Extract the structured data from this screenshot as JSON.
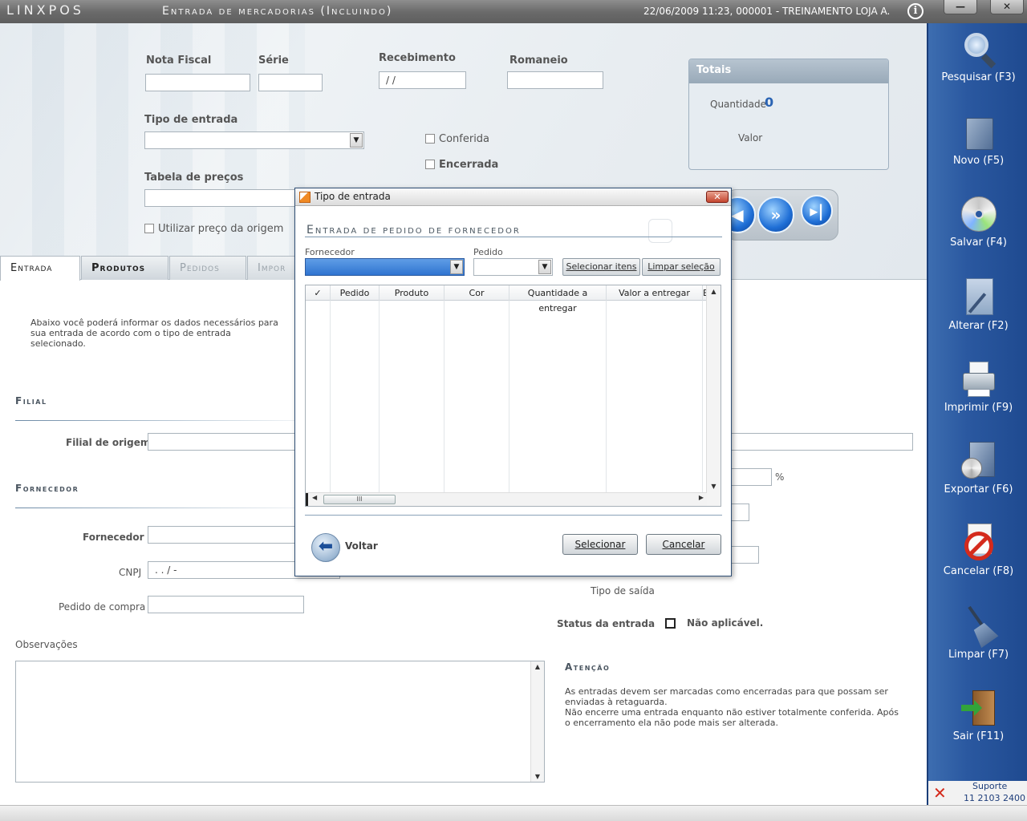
{
  "titlebar": {
    "brand": "LINXPOS",
    "title": "Entrada de mercadorias (Incluindo)",
    "status": "22/06/2009 11:23, 000001 - TREINAMENTO LOJA A.",
    "info_icon": "info-icon",
    "minimize_label": "—",
    "close_label": "✕"
  },
  "header": {
    "nota_fiscal_label": "Nota Fiscal",
    "serie_label": "Série",
    "recebimento_label": "Recebimento",
    "recebimento_value": "/ /",
    "romaneio_label": "Romaneio",
    "tipo_entrada_label": "Tipo de entrada",
    "conferida_label": "Conferida",
    "encerrada_label": "Encerrada",
    "tabela_precos_label": "Tabela de preços",
    "utilizar_preco_label": "Utilizar preço da origem"
  },
  "totais": {
    "title": "Totais",
    "quantidade_label": "Quantidade",
    "quantidade_value": "0",
    "valor_label": "Valor"
  },
  "tabs": [
    {
      "label": "Entrada"
    },
    {
      "label": "Produtos"
    },
    {
      "label": "Pedidos"
    },
    {
      "label": "Impor"
    }
  ],
  "entrada": {
    "intro": "Abaixo você poderá informar os dados necessários para sua entrada de acordo com o tipo de entrada selecionado.",
    "filial_section": "Filial",
    "filial_origem_label": "Filial de origem",
    "fornecedor_section": "Fornecedor",
    "fornecedor_label": "Fornecedor",
    "cnpj_label": "CNPJ",
    "cnpj_value": ".  .  /    -",
    "pedido_compra_label": "Pedido de compra",
    "observacoes_label": "Observações",
    "percent_label": "%",
    "tipo_saida_label": "Tipo de saída",
    "status_entrada_label": "Status da entrada",
    "status_value": "Não aplicável.",
    "atencao_title": "Atenção",
    "atencao_text_1": "As entradas devem ser marcadas como encerradas para que possam ser enviadas à retaguarda.",
    "atencao_text_2": "Não encerre uma entrada enquanto não estiver totalmente conferida. Após o encerramento ela não pode mais ser alterada."
  },
  "sidebar": {
    "items": [
      {
        "label": "Pesquisar (F3)",
        "icon": "magnifier-icon"
      },
      {
        "label": "Novo (F5)",
        "icon": "new-document-icon"
      },
      {
        "label": "Salvar (F4)",
        "icon": "disc-icon"
      },
      {
        "label": "Alterar (F2)",
        "icon": "edit-document-icon"
      },
      {
        "label": "Imprimir (F9)",
        "icon": "printer-icon"
      },
      {
        "label": "Exportar (F6)",
        "icon": "export-icon"
      },
      {
        "label": "Cancelar (F8)",
        "icon": "cancel-icon"
      },
      {
        "label": "Limpar (F7)",
        "icon": "broom-icon"
      },
      {
        "label": "Sair (F11)",
        "icon": "exit-door-icon"
      }
    ],
    "support_label": "Suporte",
    "support_phone": "11 2103 2400"
  },
  "dialog": {
    "title": "Tipo de entrada",
    "heading": "Entrada de pedido de fornecedor",
    "fornecedor_label": "Fornecedor",
    "pedido_label": "Pedido",
    "selecionar_itens": "Selecionar itens",
    "limpar_selecao": "Limpar seleção",
    "columns": [
      "✓",
      "Pedido",
      "Produto",
      "Cor",
      "Quantidade a entregar",
      "Valor a entregar",
      "E"
    ],
    "voltar": "Voltar",
    "selecionar": "Selecionar",
    "cancelar": "Cancelar",
    "close_label": "✕"
  }
}
